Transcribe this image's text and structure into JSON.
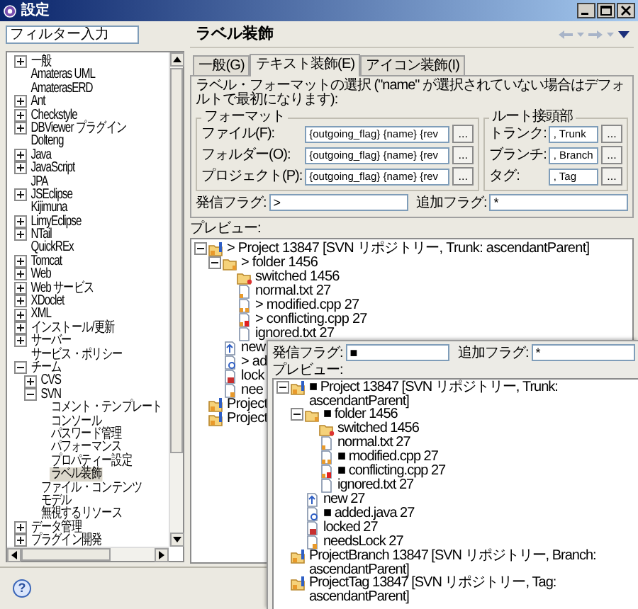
{
  "window": {
    "title": "設定"
  },
  "filter": {
    "placeholder": "フィルター入力"
  },
  "nav_tree": [
    {
      "label": "一般",
      "expanded": false,
      "selected": false
    },
    {
      "label": "Amateras UML",
      "selected": false
    },
    {
      "label": "AmaterasERD",
      "selected": false
    },
    {
      "label": "Ant",
      "expanded": false,
      "selected": false
    },
    {
      "label": "Checkstyle",
      "expanded": false,
      "selected": false
    },
    {
      "label": "DBViewer プラグイン",
      "expanded": false,
      "selected": false
    },
    {
      "label": "Dolteng",
      "selected": false
    },
    {
      "label": "Java",
      "expanded": false,
      "selected": false
    },
    {
      "label": "JavaScript",
      "expanded": false,
      "selected": false
    },
    {
      "label": "JPA",
      "selected": false
    },
    {
      "label": "JSEclipse",
      "expanded": false,
      "selected": false
    },
    {
      "label": "Kijimuna",
      "selected": false
    },
    {
      "label": "LimyEclipse",
      "expanded": false,
      "selected": false
    },
    {
      "label": "NTail",
      "expanded": false,
      "selected": false
    },
    {
      "label": "QuickREx",
      "selected": false
    },
    {
      "label": "Tomcat",
      "expanded": false,
      "selected": false
    },
    {
      "label": "Web",
      "expanded": false,
      "selected": false
    },
    {
      "label": "Web サービス",
      "expanded": false,
      "selected": false
    },
    {
      "label": "XDoclet",
      "expanded": false,
      "selected": false
    },
    {
      "label": "XML",
      "expanded": false,
      "selected": false
    },
    {
      "label": "インストール/更新",
      "expanded": false,
      "selected": false
    },
    {
      "label": "サーバー",
      "expanded": false,
      "selected": false
    },
    {
      "label": "サービス・ポリシー",
      "selected": false
    },
    {
      "label": "チーム",
      "expanded": true,
      "selected": false,
      "children": [
        {
          "label": "CVS",
          "expanded": false,
          "selected": false
        },
        {
          "label": "SVN",
          "expanded": true,
          "selected": false,
          "children": [
            {
              "label": "コメント・テンプレート",
              "selected": false
            },
            {
              "label": "コンソール",
              "selected": false
            },
            {
              "label": "パスワード管理",
              "selected": false
            },
            {
              "label": "パフォーマンス",
              "selected": false
            },
            {
              "label": "プロパティー設定",
              "selected": false
            },
            {
              "label": "ラベル装飾",
              "selected": true
            }
          ]
        },
        {
          "label": "ファイル・コンテンツ",
          "selected": false
        },
        {
          "label": "モデル",
          "selected": false
        },
        {
          "label": "無視するリソース",
          "selected": false
        }
      ]
    },
    {
      "label": "データ管理",
      "expanded": false,
      "selected": false
    },
    {
      "label": "プラグイン開発",
      "expanded": false,
      "selected": false
    }
  ],
  "help": "?",
  "page": {
    "title": "ラベル装飾"
  },
  "tabs": [
    {
      "label": "一般(G)",
      "selected": false
    },
    {
      "label": "テキスト装飾(E)",
      "selected": true
    },
    {
      "label": "アイコン装飾(I)",
      "selected": false
    }
  ],
  "text_tab": {
    "description": "ラベル・フォーマットの選択 (\"name\" が選択されていない場合はデフォルトで最初になります):",
    "format": {
      "title": "フォーマット",
      "rows": [
        {
          "label": "ファイル(F):",
          "value": "{outgoing_flag} {name} {rev",
          "button": "..."
        },
        {
          "label": "フォルダー(O):",
          "value": "{outgoing_flag} {name} {rev",
          "button": "..."
        },
        {
          "label": "プロジェクト(P):",
          "value": "{outgoing_flag} {name} {rev",
          "button": "..."
        }
      ]
    },
    "root_prefix": {
      "title": "ルート接頭部",
      "rows": [
        {
          "label": "トランク:",
          "value": ", Trunk",
          "button": "..."
        },
        {
          "label": "ブランチ:",
          "value": ", Branch",
          "button": "..."
        },
        {
          "label": "タグ:",
          "value": ", Tag",
          "button": "..."
        }
      ]
    },
    "flags": [
      {
        "label": "発信フラグ:",
        "value": ">"
      },
      {
        "label": "追加フラグ:",
        "value": "*"
      }
    ]
  },
  "preview": {
    "label": "プレビュー:",
    "tree": [
      {
        "text": "> Project 13847 [SVN リポジトリー, Trunk: ascendantParent]",
        "kind": "project",
        "expanded": true,
        "children": [
          {
            "text": "> folder 1456",
            "kind": "folder",
            "expanded": true,
            "children": [
              {
                "text": "switched 1456",
                "kind": "switched"
              },
              {
                "text": "normal.txt 27",
                "kind": "file"
              },
              {
                "text": "> modified.cpp 27",
                "kind": "modified"
              },
              {
                "text": "> conflicting.cpp 27",
                "kind": "conflict"
              },
              {
                "text": "ignored.txt 27",
                "kind": "ignored"
              }
            ]
          },
          {
            "text": "new",
            "kind": "new"
          },
          {
            "text": "> ad",
            "kind": "added"
          },
          {
            "text": "lock",
            "kind": "locked"
          },
          {
            "text": "nee",
            "kind": "needslock"
          }
        ]
      },
      {
        "text": "Project",
        "kind": "project"
      },
      {
        "text": "Project",
        "kind": "project"
      }
    ]
  },
  "inset": {
    "flags": [
      {
        "label": "発信フラグ:",
        "value": "■"
      },
      {
        "label": "追加フラグ:",
        "value": "*"
      }
    ],
    "preview": {
      "label": "プレビュー:",
      "tree": [
        {
          "text": "■ Project 13847 [SVN リポジトリー, Trunk: ascendantParent]",
          "kind": "project",
          "expanded": true,
          "children": [
            {
              "text": "■ folder 1456",
              "kind": "folder",
              "expanded": true,
              "children": [
                {
                  "text": "switched 1456",
                  "kind": "switched"
                },
                {
                  "text": "normal.txt 27",
                  "kind": "file"
                },
                {
                  "text": "■ modified.cpp 27",
                  "kind": "modified"
                },
                {
                  "text": "■ conflicting.cpp 27",
                  "kind": "conflict"
                },
                {
                  "text": "ignored.txt 27",
                  "kind": "ignored"
                }
              ]
            },
            {
              "text": "new 27",
              "kind": "new"
            },
            {
              "text": "■ added.java 27",
              "kind": "added"
            },
            {
              "text": "locked 27",
              "kind": "locked"
            },
            {
              "text": "needsLock 27",
              "kind": "needslock"
            }
          ]
        },
        {
          "text": "ProjectBranch 13847 [SVN リポジトリー, Branch: ascendantParent]",
          "kind": "project"
        },
        {
          "text": "ProjectTag 13847 [SVN リポジトリー, Tag: ascendantParent]",
          "kind": "project"
        }
      ]
    }
  }
}
